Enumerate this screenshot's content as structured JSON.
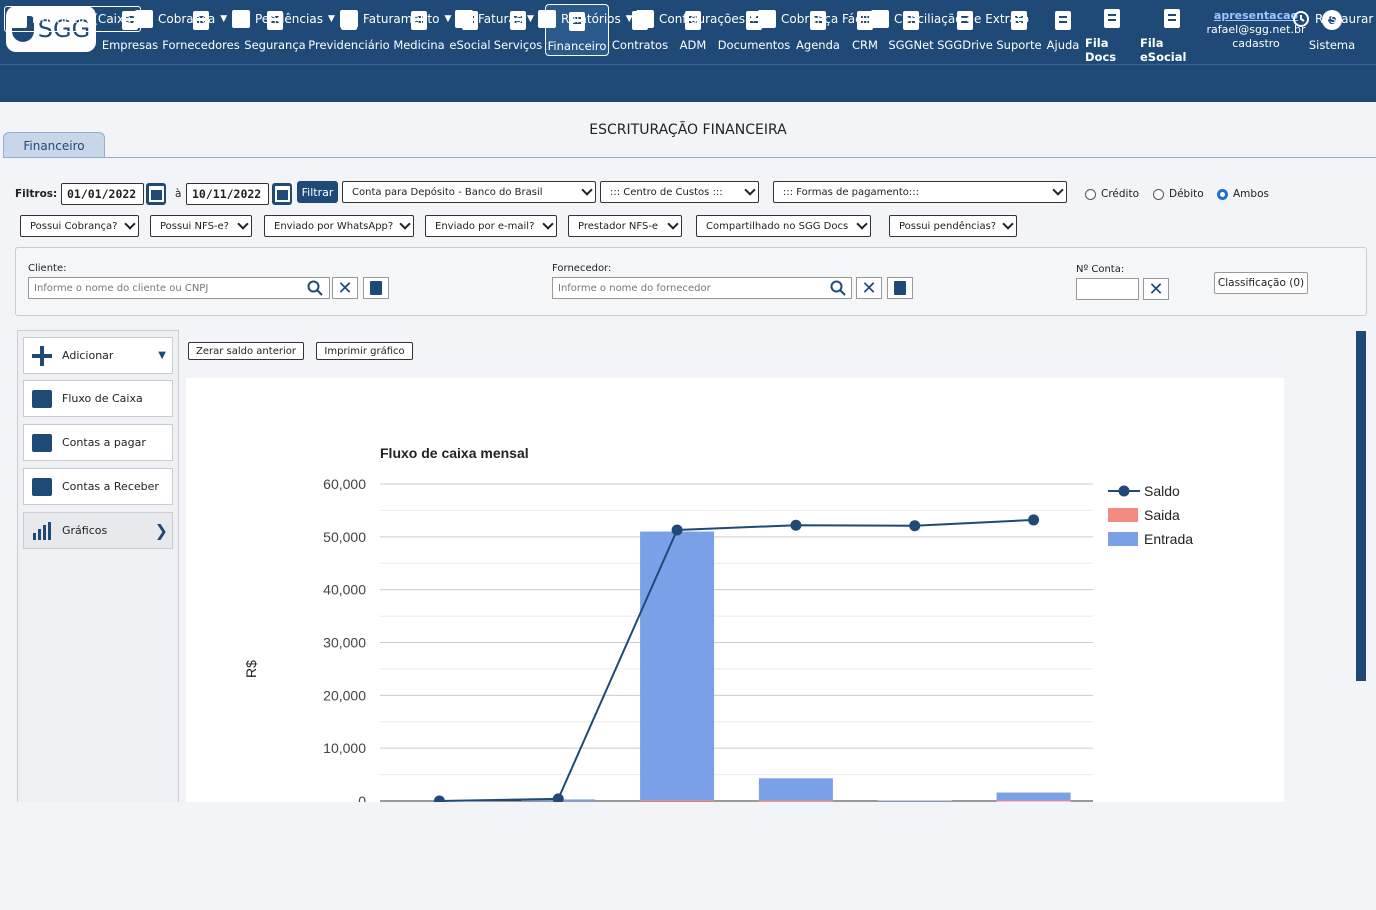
{
  "top_nav": {
    "logo_text": "SGG",
    "items": [
      {
        "label": "Empresas",
        "icon": "building-icon"
      },
      {
        "label": "Fornecedores",
        "icon": "truck-icon"
      },
      {
        "label": "Segurança",
        "icon": "hardhat-icon"
      },
      {
        "label": "Previdenciário",
        "icon": "handshake-icon"
      },
      {
        "label": "Medicina",
        "icon": "stethoscope-icon"
      },
      {
        "label": "eSocial",
        "icon": "document-icon"
      },
      {
        "label": "Serviços",
        "icon": "layers-icon"
      },
      {
        "label": "Financeiro",
        "icon": "moneybag-icon"
      },
      {
        "label": "Contratos",
        "icon": "contract-icon"
      },
      {
        "label": "ADM",
        "icon": "folder-icon"
      },
      {
        "label": "Documentos",
        "icon": "documents-icon"
      },
      {
        "label": "Agenda",
        "icon": "calendar-icon"
      },
      {
        "label": "CRM",
        "icon": "crm-icon"
      },
      {
        "label": "SGGNet",
        "icon": "net-icon"
      },
      {
        "label": "SGGDrive",
        "icon": "cloud-icon"
      },
      {
        "label": "Suporte",
        "icon": "headset-icon"
      },
      {
        "label": "Ajuda",
        "icon": "help-icon"
      },
      {
        "label": "Fila Docs",
        "icon": "queue-docs-icon"
      },
      {
        "label": "Fila eSocial",
        "icon": "queue-esocial-icon"
      }
    ],
    "user": {
      "name": "apresentacao",
      "email": "rafael@sgg.net.br",
      "sub": "cadastro"
    },
    "sistema_label": "Sistema"
  },
  "menu_bar": {
    "items": [
      "Financeiro(Caixa)",
      "Cobrança",
      "Pendências",
      "Faturamento",
      "Faturas",
      "Relatórios",
      "Configurações",
      "Cobrança Fácil",
      "Conciliação de Extrato"
    ],
    "restore_label": "Restaurar"
  },
  "page": {
    "title": "ESCRITURAÇÃO FINANCEIRA",
    "tab": "Financeiro"
  },
  "filters": {
    "label": "Filtros:",
    "date_from": "01/01/2022",
    "date_sep": "à",
    "date_to": "10/11/2022",
    "filter_button": "Filtrar",
    "account": "Conta para Depósito - Banco do Brasil",
    "cost_center": "::: Centro de Custos :::",
    "payment_forms": "::: Formas de pagamento:::",
    "radio": [
      "Crédito",
      "Débito",
      "Ambos"
    ],
    "radio_selected": "Ambos",
    "dropdowns": [
      "Possui Cobrança?",
      "Possui NFS-e?",
      "Enviado por WhatsApp?",
      "Enviado por e-mail?",
      "Prestador NFS-e",
      "Compartilhado no SGG Docs",
      "Possui pendências?"
    ]
  },
  "search": {
    "client_label": "Cliente:",
    "client_placeholder": "Informe o nome do cliente ou CNPJ",
    "supplier_label": "Fornecedor:",
    "supplier_placeholder": "Informe o nome do fornecedor",
    "account_no_label": "Nº Conta:",
    "classification_button": "Classificação (0)"
  },
  "sidebar": {
    "items": [
      {
        "label": "Adicionar",
        "icon": "plus-icon"
      },
      {
        "label": "Fluxo de Caixa",
        "icon": "cash-register-icon"
      },
      {
        "label": "Contas a pagar",
        "icon": "wallet-icon"
      },
      {
        "label": "Contas a Receber",
        "icon": "receivable-icon"
      },
      {
        "label": "Gráficos",
        "icon": "bar-chart-icon"
      }
    ]
  },
  "content": {
    "reset_button": "Zerar saldo anterior",
    "print_button": "Imprimir gráfico"
  },
  "colors": {
    "primary": "#1f4a78",
    "saldo": "#1f4a78",
    "saida": "#f28b82",
    "entrada": "#7aa0e8"
  },
  "chart_data": {
    "type": "bar",
    "title": "Fluxo de caixa mensal",
    "ylabel": "R$",
    "ylim": [
      0,
      60000
    ],
    "yticks": [
      "0",
      "10,000",
      "20,000",
      "30,000",
      "40,000",
      "50,000",
      "60,000"
    ],
    "categories": [
      "",
      "",
      "",
      "",
      "",
      ""
    ],
    "series": [
      {
        "name": "Saldo",
        "kind": "line",
        "values": [
          0,
          400,
          51300,
          52200,
          52100,
          53200
        ]
      },
      {
        "name": "Saida",
        "kind": "bar",
        "values": [
          0,
          0,
          200,
          150,
          0,
          100
        ]
      },
      {
        "name": "Entrada",
        "kind": "bar",
        "values": [
          0,
          300,
          51000,
          4300,
          100,
          1600
        ]
      }
    ],
    "legend": "right",
    "grid": true
  }
}
